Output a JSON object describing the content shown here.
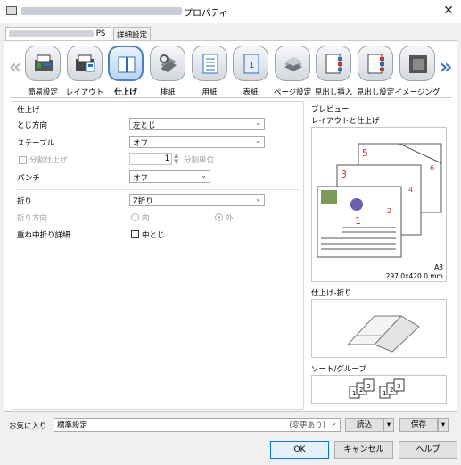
{
  "window": {
    "title": "プロパティ",
    "close_glyph": "✕"
  },
  "tabs": [
    {
      "label": "PS"
    },
    {
      "label": "詳細設定"
    }
  ],
  "categories": [
    {
      "label": "簡易設定",
      "icon": "quick-setup-icon"
    },
    {
      "label": "レイアウト",
      "icon": "layout-icon"
    },
    {
      "label": "仕上げ",
      "icon": "finishing-icon",
      "selected": true
    },
    {
      "label": "排紙",
      "icon": "output-icon"
    },
    {
      "label": "用紙",
      "icon": "paper-icon"
    },
    {
      "label": "表紙",
      "icon": "cover-icon"
    },
    {
      "label": "ページ設定",
      "icon": "page-setup-icon"
    },
    {
      "label": "見出し挿入",
      "icon": "tab-insert-icon"
    },
    {
      "label": "見出し設定",
      "icon": "tab-setting-icon"
    },
    {
      "label": "イメージング",
      "icon": "imaging-icon"
    }
  ],
  "nav": {
    "left_arrow": "«",
    "right_arrow": "»"
  },
  "finishing": {
    "group_title": "仕上げ",
    "binding_position": {
      "label": "とじ方向",
      "value": "左とじ"
    },
    "staple": {
      "label": "ステープル",
      "value": "オフ"
    },
    "offset": {
      "label": "分割仕上げ",
      "value": "1",
      "unit": "分割単位"
    },
    "punch": {
      "label": "パンチ",
      "value": "オフ"
    },
    "fold": {
      "label": "折り",
      "value": "Z折り"
    },
    "fold_direction": {
      "label": "折り方向",
      "option_in": "内",
      "option_out": "外",
      "selected": "外"
    },
    "saddle_detail": {
      "label": "重ね中折り詳細",
      "checkbox_label": "中とじ",
      "checked": false
    }
  },
  "preview": {
    "group_title": "プレビュー",
    "layout_title": "レイアウトと仕上げ",
    "paper_size": "A3",
    "paper_dimensions": "297.0x420.0 mm",
    "finish_fold_title": "仕上げ-折り",
    "sort_group_title": "ソート/グループ",
    "page_numbers": [
      "5",
      "6",
      "3",
      "4",
      "1",
      "2"
    ],
    "sort_numbers": [
      "1",
      "2",
      "3"
    ]
  },
  "favorites": {
    "label": "お気に入り",
    "value": "標準設定",
    "modified": "(変更あり)",
    "load_button": "読込",
    "save_button": "保存"
  },
  "buttons": {
    "ok": "OK",
    "cancel": "キャンセル",
    "help": "ヘルプ"
  }
}
